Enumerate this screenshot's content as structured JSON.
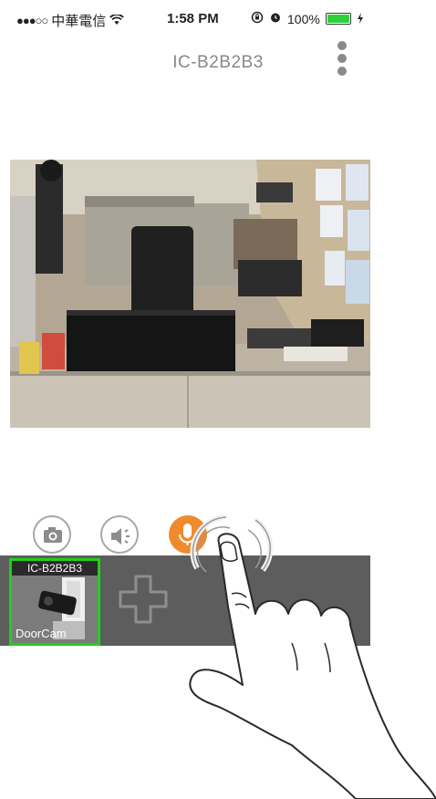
{
  "status_bar": {
    "signal": "●●●○○",
    "carrier": "中華電信",
    "time": "1:58 PM",
    "battery_percent": "100%"
  },
  "header": {
    "title": "IC-B2B2B3"
  },
  "controls": {
    "snapshot_icon": "camera-icon",
    "speaker_icon": "speaker-icon",
    "mic_icon": "microphone-icon",
    "mic_active_color": "#ef8a2e"
  },
  "camera_list": {
    "items": [
      {
        "name": "IC-B2B2B3",
        "label": "DoorCam",
        "selected": true
      }
    ],
    "add_icon": "plus-icon",
    "selected_border_color": "#1fd11a"
  },
  "overlay": {
    "gesture": "tap-hand-icon"
  }
}
